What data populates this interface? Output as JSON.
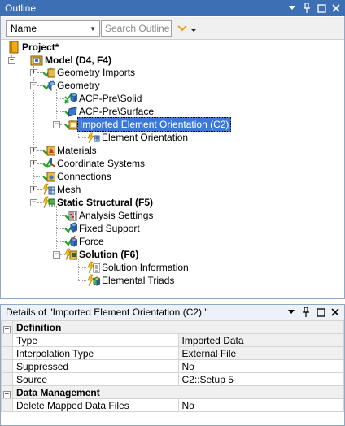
{
  "outline": {
    "title": "Outline",
    "name_filter": "Name",
    "search_placeholder": "Search Outline",
    "tree": {
      "project": "Project*",
      "model": "Model (D4, F4)",
      "geometry_imports": "Geometry Imports",
      "geometry": "Geometry",
      "acp_solid": "ACP-Pre\\Solid",
      "acp_surface": "ACP-Pre\\Surface",
      "imported_orientation": "Imported Element Orientation (C2)",
      "element_orientation": "Element Orientation",
      "materials": "Materials",
      "coordinate_systems": "Coordinate Systems",
      "connections": "Connections",
      "mesh": "Mesh",
      "static_structural": "Static Structural (F5)",
      "analysis_settings": "Analysis Settings",
      "fixed_support": "Fixed Support",
      "force": "Force",
      "solution": "Solution (F6)",
      "solution_information": "Solution Information",
      "elemental_triads": "Elemental Triads"
    }
  },
  "details": {
    "title": "Details of \"Imported Element Orientation (C2) \"",
    "groups": [
      {
        "name": "Definition",
        "rows": [
          {
            "key": "Type",
            "value": "Imported Data"
          },
          {
            "key": "Interpolation Type",
            "value": "External File"
          },
          {
            "key": "Suppressed",
            "value": "No"
          },
          {
            "key": "Source",
            "value": "C2::Setup 5"
          }
        ]
      },
      {
        "name": "Data Management",
        "rows": [
          {
            "key": "Delete Mapped Data Files",
            "value": "No"
          }
        ]
      }
    ]
  },
  "colors": {
    "title_bar": "#3c6fb4",
    "selection": "#3c78d8",
    "check_green": "#1fa12a",
    "lightning_yellow": "#f2c40e",
    "folder_yellow": "#e8b84a"
  }
}
